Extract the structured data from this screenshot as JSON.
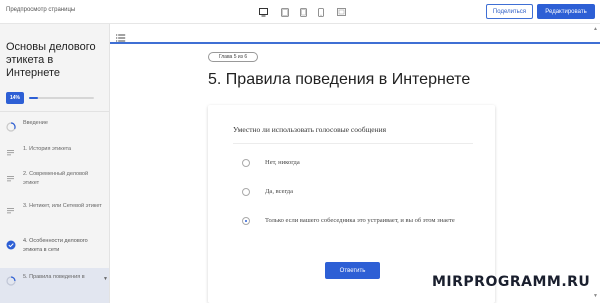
{
  "topbar": {
    "title": "Предпросмотр страницы",
    "devices": [
      "desktop-icon",
      "tablet-landscape-icon",
      "tablet-icon",
      "phone-icon",
      "fullscreen-icon"
    ],
    "share_label": "Поделиться",
    "edit_label": "Редактировать"
  },
  "sidebar": {
    "course_title": "Основы делового этикета в Интернете",
    "progress_label": "14%",
    "progress_value": 0.14,
    "items": [
      {
        "label": "Введение",
        "icon": "progress-circle-icon",
        "state": "in-progress"
      },
      {
        "label": "1. История этикета",
        "icon": "lines-icon",
        "state": "todo"
      },
      {
        "label": "2. Современный деловой этикет",
        "icon": "lines-icon",
        "state": "todo"
      },
      {
        "label": "3. Нетикет, или Сетевой этикет",
        "icon": "lines-icon",
        "state": "todo"
      },
      {
        "label": "4. Особенности делового этикета в сети",
        "icon": "check-circle-icon",
        "state": "done"
      },
      {
        "label": "5. Правила поведения в",
        "icon": "progress-circle-icon",
        "state": "active"
      }
    ]
  },
  "main": {
    "page_tag": "Глава 5 из 6",
    "heading": "5. Правила поведения в Интернете",
    "question": "Уместно ли использовать голосовые сообщения",
    "options": [
      {
        "text": "Нет, никогда",
        "selected": false
      },
      {
        "text": "Да, всегда",
        "selected": false
      },
      {
        "text": "Только если вашего собеседника это устраивает, и вы об этом знаете",
        "selected": true
      }
    ],
    "submit_label": "Ответить"
  },
  "watermark": "MIRPROGRAMM.RU",
  "colors": {
    "accent": "#2d5fd5",
    "sidebar_bg": "#f4f4f4",
    "active_item_bg": "#e2e6f0"
  }
}
